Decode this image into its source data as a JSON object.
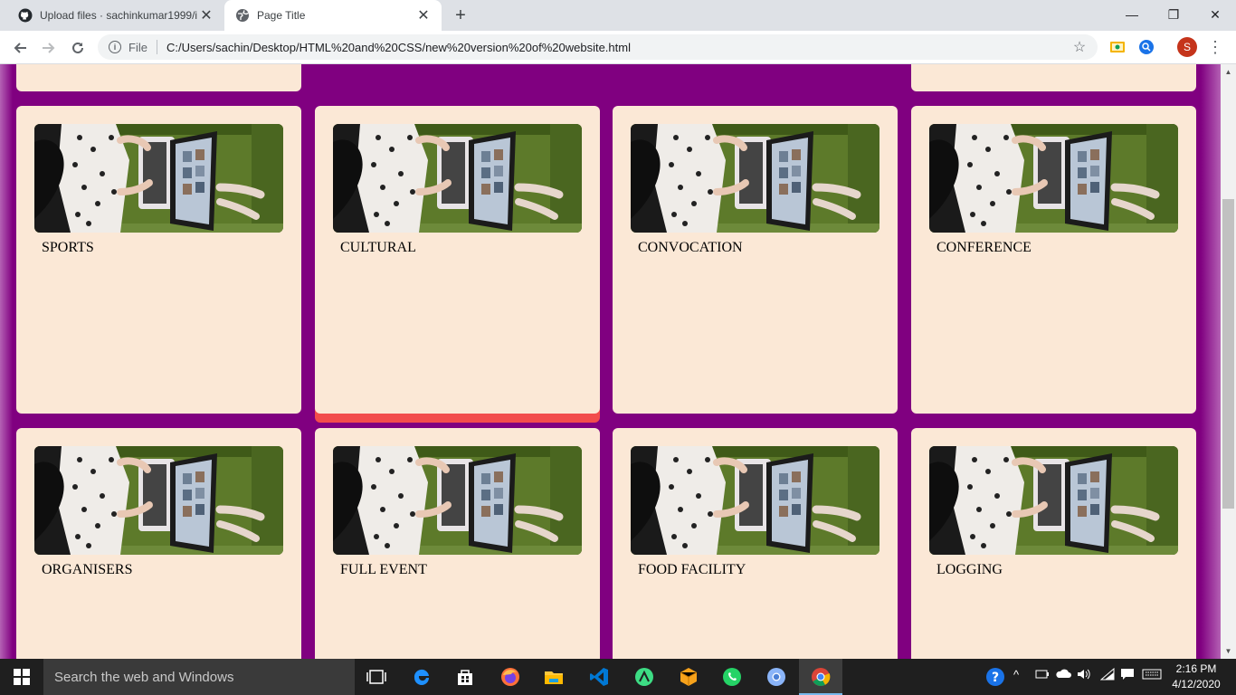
{
  "browser": {
    "tabs": [
      {
        "title": "Upload files · sachinkumar1999/i",
        "active": false
      },
      {
        "title": "Page Title",
        "active": true
      }
    ],
    "new_tab_label": "+",
    "address": {
      "scheme_label": "File",
      "url": "C:/Users/sachin/Desktop/HTML%20and%20CSS/new%20version%20of%20website.html"
    },
    "profile_initial": "S"
  },
  "page": {
    "cards": [
      {
        "label": "SPORTS"
      },
      {
        "label": "CULTURAL"
      },
      {
        "label": "CONVOCATION"
      },
      {
        "label": "CONFERENCE"
      },
      {
        "label": "ORGANISERS"
      },
      {
        "label": "FULL EVENT"
      },
      {
        "label": "FOOD FACILITY"
      },
      {
        "label": "LOGGING"
      }
    ],
    "colors": {
      "background": "#800080",
      "card": "#fbe8d6",
      "hover_bar": "#f24c4c"
    }
  },
  "taskbar": {
    "search_placeholder": "Search the web and Windows",
    "time": "2:16 PM",
    "date": "4/12/2020"
  }
}
